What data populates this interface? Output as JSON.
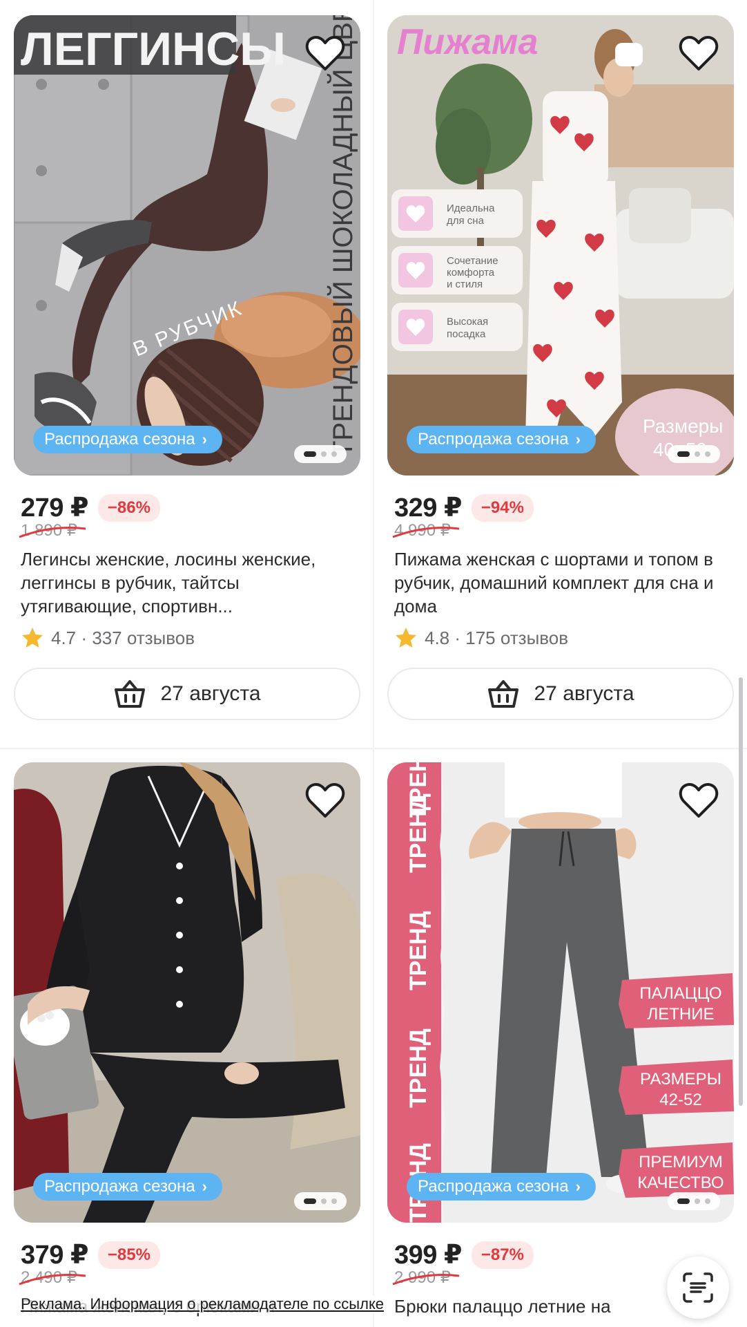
{
  "products": [
    {
      "price": "279 ₽",
      "discount": "−86%",
      "old_price": "1 890 ₽",
      "title": "Легинсы женские, лосины женские, леггинсы в рубчик, тайтсы утягивающие, спортивн...",
      "rating": "4.7 · 337 отзывов",
      "promo": "Распродажа сезона",
      "delivery": "27 августа",
      "image_text": {
        "headline": "ЛЕГГИНСЫ",
        "side": "ТРЕНДОВЫЙ ШОКОЛАДНЫЙ ЦВЕТ",
        "badge": "В РУБЧИК"
      }
    },
    {
      "price": "329 ₽",
      "discount": "−94%",
      "old_price": "4 990 ₽",
      "title": "Пижама женская с шортами и топом в рубчик, домашний комплект для сна и дома",
      "rating": "4.8 · 175 отзывов",
      "promo": "Распродажа сезона",
      "delivery": "27 августа",
      "image_text": {
        "headline": "Пижама",
        "features": [
          "Идеальна для сна",
          "Сочетание комфорта и стиля",
          "Высокая посадка"
        ],
        "sizes_label": "Размеры",
        "sizes_value": "40–50"
      }
    },
    {
      "price": "379 ₽",
      "discount": "−85%",
      "old_price": "2 490 ₽",
      "title": "Пижама женская, с брюками и",
      "promo": "Распродажа сезона"
    },
    {
      "price": "399 ₽",
      "discount": "−87%",
      "old_price": "2 990 ₽",
      "title": "Брюки палаццо летние на",
      "promo": "Распродажа сезона",
      "image_text": {
        "trend_word": "ТРЕНД",
        "tags": [
          "ПАЛАЦЦО ЛЕТНИЕ",
          "РАЗМЕРЫ 42-52",
          "ПРЕМИУМ КАЧЕСТВО"
        ]
      }
    }
  ],
  "ad_notice": "Реклама. Информация о рекламодателе по ссылке",
  "icons": {
    "favorite": "heart-outline-icon",
    "cart": "basket-icon",
    "rating": "star-icon",
    "lens": "scan-search-icon"
  },
  "colors": {
    "promo": "#5db4f3",
    "discount_text": "#e0393e",
    "discount_bg": "#fde8e8",
    "star": "#f5b82e",
    "trend_pink": "#e0607a"
  }
}
